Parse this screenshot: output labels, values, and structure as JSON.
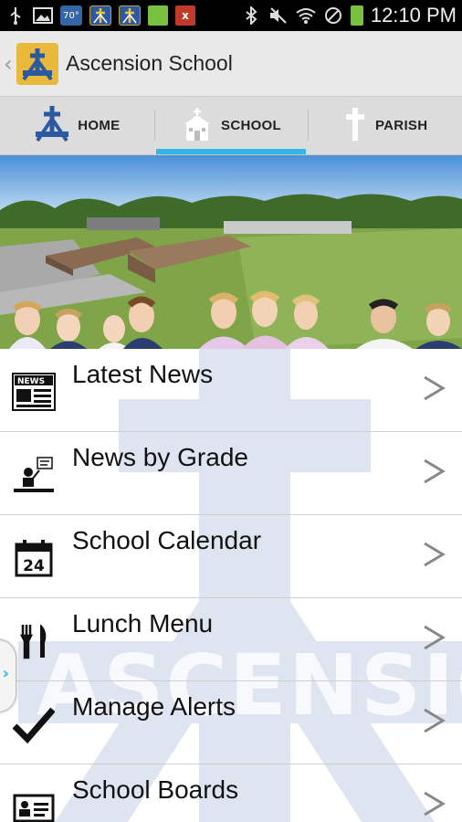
{
  "status_bar": {
    "time": "12:10 PM",
    "weather_temp": "70°",
    "notification_x": "x"
  },
  "action_bar": {
    "title": "Ascension School"
  },
  "tabs": [
    {
      "label": "HOME",
      "icon": "ascension-logo-icon",
      "active": false
    },
    {
      "label": "SCHOOL",
      "icon": "schoolhouse-icon",
      "active": true
    },
    {
      "label": "PARISH",
      "icon": "cross-icon",
      "active": false
    }
  ],
  "accent_color": "#33b5e5",
  "menu": {
    "items": [
      {
        "label": "Latest News",
        "icon": "newspaper-icon"
      },
      {
        "label": "News by Grade",
        "icon": "teacher-chalkboard-icon"
      },
      {
        "label": "School Calendar",
        "icon": "calendar-icon"
      },
      {
        "label": "Lunch Menu",
        "icon": "fork-knife-icon"
      },
      {
        "label": "Manage Alerts",
        "icon": "checkmark-icon"
      },
      {
        "label": "School Boards",
        "icon": "id-card-icon"
      }
    ],
    "calendar_day": "24",
    "chevron": ">"
  },
  "hero": {
    "watermark_text": "ASCENSION"
  }
}
